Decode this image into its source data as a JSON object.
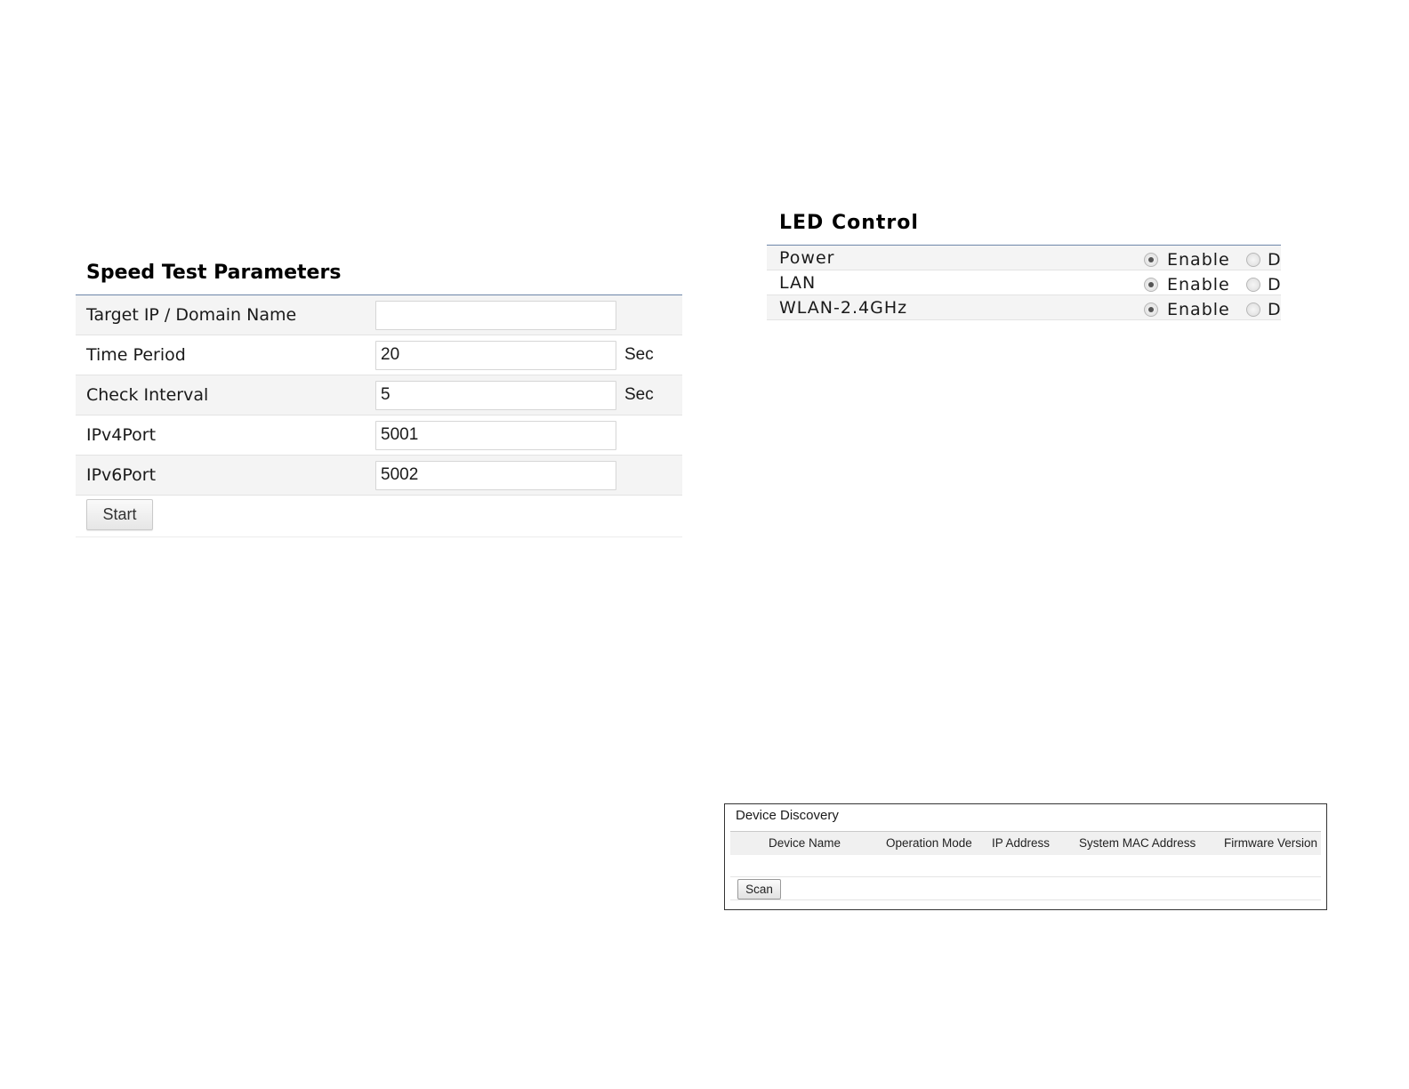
{
  "speed_test": {
    "title": "Speed Test Parameters",
    "rows": [
      {
        "label": "Target IP / Domain Name",
        "value": "",
        "unit": ""
      },
      {
        "label": "Time Period",
        "value": "20",
        "unit": "Sec"
      },
      {
        "label": "Check Interval",
        "value": "5",
        "unit": "Sec"
      },
      {
        "label": "IPv4Port",
        "value": "5001",
        "unit": ""
      },
      {
        "label": "IPv6Port",
        "value": "5002",
        "unit": ""
      }
    ],
    "start_label": "Start"
  },
  "led_control": {
    "title": "LED Control",
    "rows": [
      {
        "label": "Power",
        "enable_label": "Enable",
        "disable_label": "D",
        "selected": "enable"
      },
      {
        "label": "LAN",
        "enable_label": "Enable",
        "disable_label": "D",
        "selected": "enable"
      },
      {
        "label": "WLAN-2.4GHz",
        "enable_label": "Enable",
        "disable_label": "D",
        "selected": "enable"
      }
    ]
  },
  "device_discovery": {
    "title": "Device Discovery",
    "columns": [
      "Device Name",
      "Operation Mode",
      "IP Address",
      "System MAC Address",
      "Firmware Version"
    ],
    "scan_label": "Scan"
  }
}
